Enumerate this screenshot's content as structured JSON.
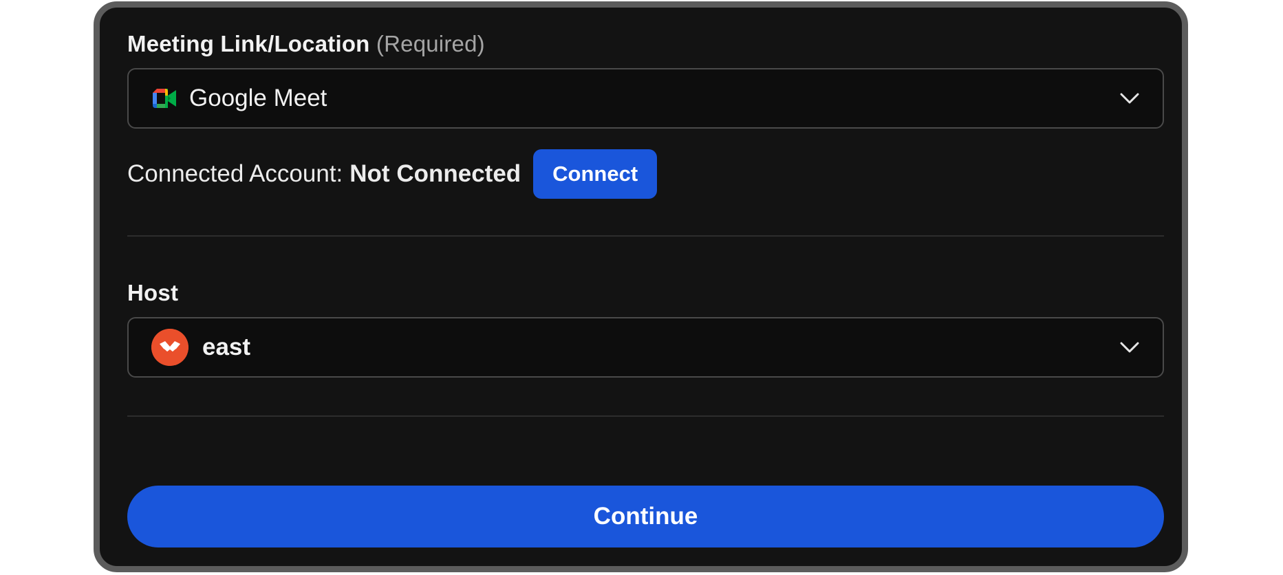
{
  "meeting_location": {
    "label": "Meeting Link/Location",
    "required_note": "(Required)",
    "selected": "Google Meet",
    "icon": "google-meet-icon"
  },
  "account": {
    "label": "Connected Account:",
    "status": "Not Connected",
    "connect_label": "Connect"
  },
  "host": {
    "label": "Host",
    "selected": "east",
    "icon": "host-avatar"
  },
  "actions": {
    "continue_label": "Continue"
  },
  "colors": {
    "background": "#131313",
    "border": "#5c5c5c",
    "primary": "#1a56db",
    "avatar": "#ea4f2b"
  }
}
